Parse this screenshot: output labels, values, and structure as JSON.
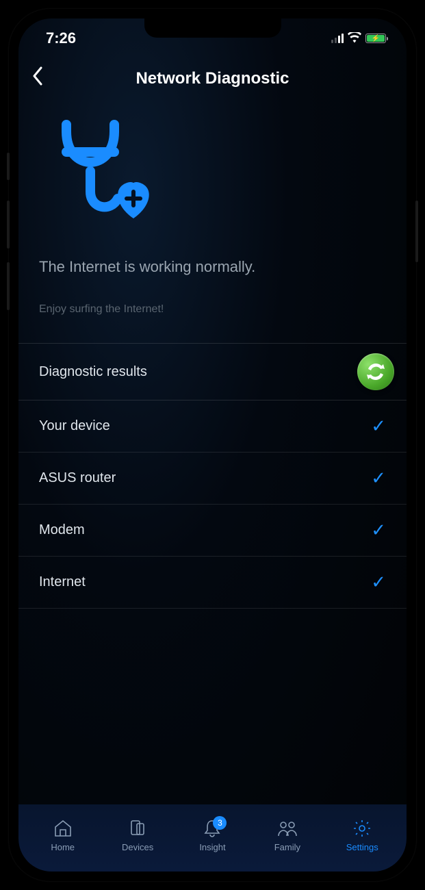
{
  "status_bar": {
    "time": "7:26"
  },
  "header": {
    "title": "Network Diagnostic"
  },
  "main": {
    "status_text": "The Internet is working normally.",
    "status_sub": "Enjoy surfing the Internet!",
    "results_label": "Diagnostic results",
    "rows": [
      {
        "label": "Your device",
        "ok": true
      },
      {
        "label": "ASUS router",
        "ok": true
      },
      {
        "label": "Modem",
        "ok": true
      },
      {
        "label": "Internet",
        "ok": true
      }
    ]
  },
  "nav": {
    "items": [
      {
        "label": "Home"
      },
      {
        "label": "Devices"
      },
      {
        "label": "Insight",
        "badge": "3"
      },
      {
        "label": "Family"
      },
      {
        "label": "Settings",
        "active": true
      }
    ]
  },
  "colors": {
    "accent": "#1a8cff",
    "success": "#34c759"
  }
}
